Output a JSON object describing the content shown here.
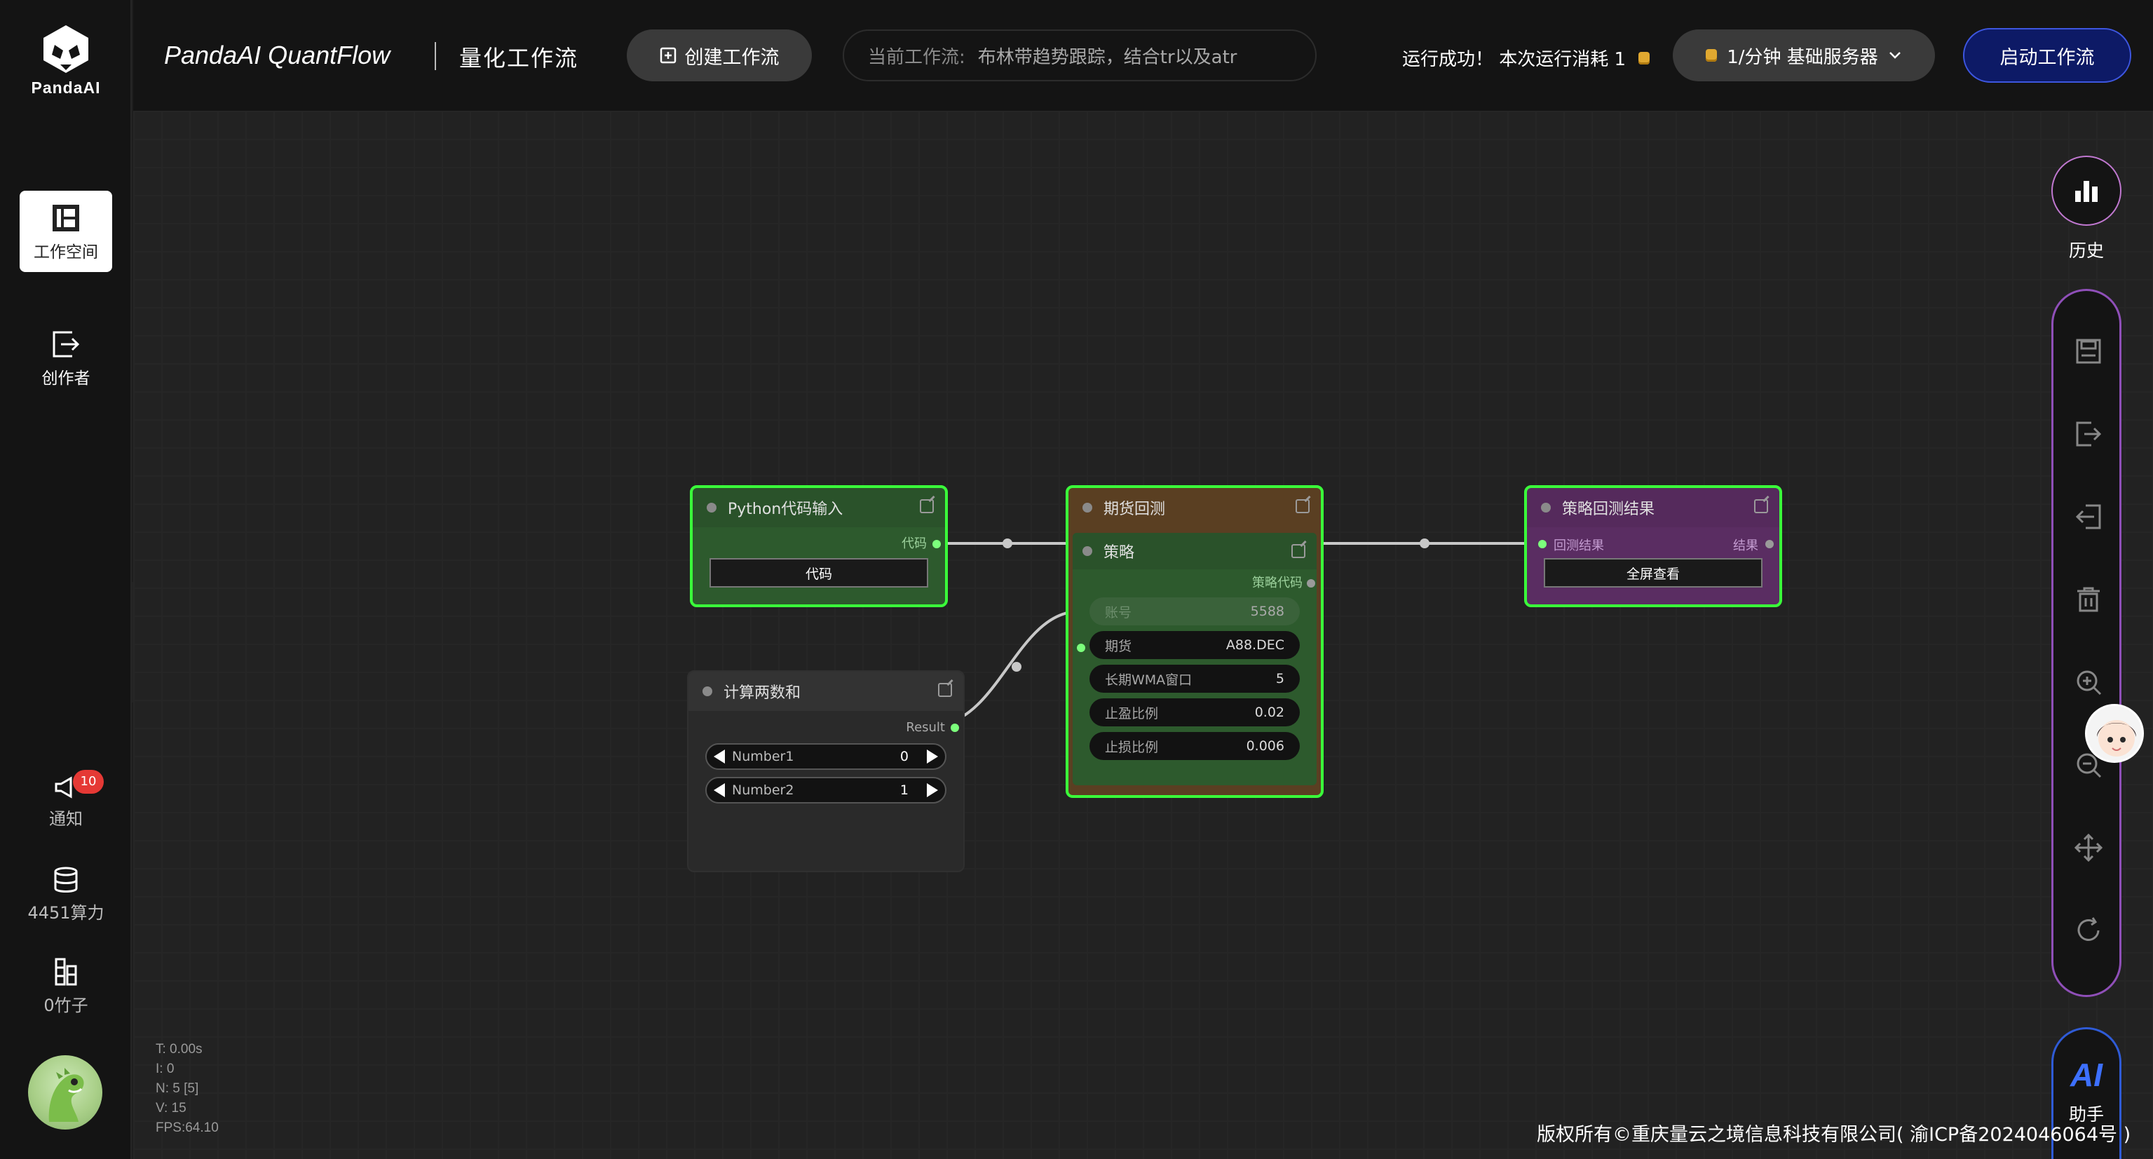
{
  "sidebar": {
    "logo_text": "PandaAI",
    "items": [
      {
        "label": "工作空间",
        "icon": "workspace-icon",
        "active": true
      },
      {
        "label": "创作者",
        "icon": "creator-icon",
        "active": false
      }
    ],
    "notice": {
      "label": "通知",
      "badge": "10"
    },
    "compute": {
      "label": "4451算力"
    },
    "bamboo": {
      "label": "0竹子"
    },
    "collapse": "›"
  },
  "topbar": {
    "brand": "PandaAI QuantFlow",
    "brand_cn": "量化工作流",
    "create_button": "创建工作流",
    "current_label": "当前工作流:",
    "current_value": "布林带趋势跟踪，结合tr以及atr",
    "run_status": "运行成功！ 本次运行消耗 1",
    "server": "1/分钟   基础服务器",
    "start_button": "启动工作流"
  },
  "nodes": {
    "python_input": {
      "title": "Python代码输入",
      "out_label": "代码",
      "button": "代码"
    },
    "sum_two": {
      "title": "计算两数和",
      "out_label": "Result",
      "fields": [
        {
          "label": "Number1",
          "value": "0"
        },
        {
          "label": "Number2",
          "value": "1"
        }
      ]
    },
    "futures_backtest": {
      "title": "期货回测",
      "sub_title": "策略",
      "port_label": "策略代码",
      "fields": [
        {
          "label": "账号",
          "value": "5588"
        },
        {
          "label": "期货",
          "value": "A88.DEC"
        },
        {
          "label": "长期WMA窗口",
          "value": "5"
        },
        {
          "label": "止盈比例",
          "value": "0.02"
        },
        {
          "label": "止损比例",
          "value": "0.006"
        }
      ]
    },
    "result": {
      "title": "策略回测结果",
      "in_label": "回测结果",
      "out_label": "结果",
      "button": "全屏查看"
    }
  },
  "right_toolbar": {
    "history": "历史",
    "tools": [
      "save-icon",
      "export-icon",
      "import-icon",
      "delete-icon",
      "zoom-in-icon",
      "zoom-out-icon",
      "move-icon",
      "refresh-icon"
    ],
    "ai": "AI",
    "ai_label": "助手"
  },
  "stats": {
    "t": "T: 0.00s",
    "i": "I: 0",
    "n": "N: 5 [5]",
    "v": "V: 15",
    "fps": "FPS:64.10"
  },
  "copyright": "版权所有©重庆量云之境信息科技有限公司( 渝ICP备2024046064号 )",
  "colors": {
    "accent_green": "#3aff3a",
    "start_button": "#0d1a66",
    "toolbar_border": "#8f4fb8"
  }
}
